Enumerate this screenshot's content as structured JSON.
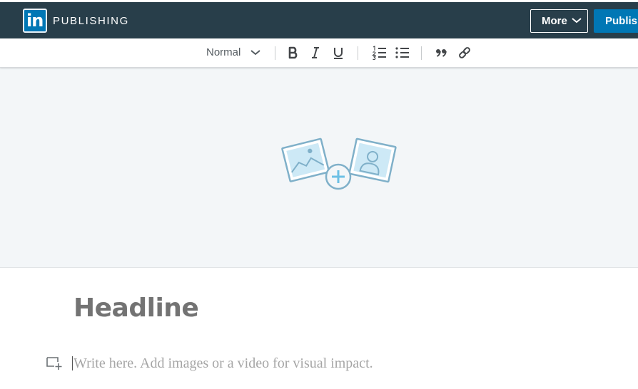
{
  "header": {
    "logo_text": "in",
    "brand": "PUBLISHING",
    "more_label": "More",
    "publish_label": "Publish"
  },
  "toolbar": {
    "text_style": "Normal",
    "buttons": [
      "bold-icon",
      "italic-icon",
      "underline-icon",
      "numbered-list-icon",
      "bulleted-list-icon",
      "quote-icon",
      "link-icon"
    ]
  },
  "cover": {
    "icon": "add-cover-image-icon"
  },
  "editor": {
    "headline_placeholder": "Headline",
    "body_placeholder": "Write here. Add images or a video for visual impact."
  },
  "colors": {
    "header_bg": "#283e4a",
    "brand_blue": "#0077b5",
    "cover_bg": "#f3f6f8",
    "icon_blue": "#7fb0c9",
    "icon_fill": "#cde9f6"
  }
}
